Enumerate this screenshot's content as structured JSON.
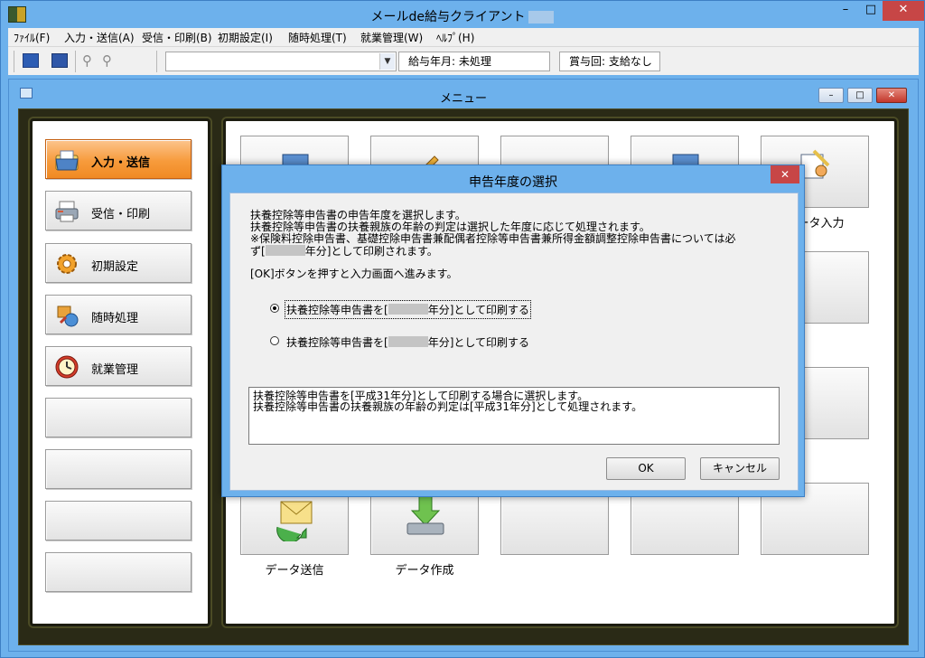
{
  "app": {
    "title": "メールde給与クライアント",
    "controls": {
      "minimize": "–",
      "maximize": "□",
      "close": "✕"
    }
  },
  "menubar": {
    "items": [
      "ﾌｧｲﾙ(F)",
      "入力・送信(A)",
      "受信・印刷(B)",
      "初期設定(I)",
      "随時処理(T)",
      "就業管理(W)",
      "ﾍﾙﾌﾟ(H)"
    ]
  },
  "toolbar": {
    "icons": [
      "monitor-icon",
      "monitor-dark-icon",
      "key-icon",
      "key-icon"
    ],
    "combo_value": "",
    "pay_label": "給与年月: 未処理",
    "bonus_label": "賞与回: 支給なし"
  },
  "mdi": {
    "title": "メニュー",
    "controls": {
      "minimize": "–",
      "maximize": "□",
      "close": "✕"
    }
  },
  "left_menu": {
    "items": [
      {
        "label": "入力・送信",
        "icon": "folder-icon",
        "active": true
      },
      {
        "label": "受信・印刷",
        "icon": "printer-icon",
        "active": false
      },
      {
        "label": "初期設定",
        "icon": "gear-icon",
        "active": false
      },
      {
        "label": "随時処理",
        "icon": "tools-icon",
        "active": false
      },
      {
        "label": "就業管理",
        "icon": "clock-icon",
        "active": false
      },
      {
        "label": "",
        "icon": "",
        "active": false
      },
      {
        "label": "",
        "icon": "",
        "active": false
      },
      {
        "label": "",
        "icon": "",
        "active": false
      },
      {
        "label": "",
        "icon": "",
        "active": false
      }
    ]
  },
  "grid": {
    "labels": {
      "data_input": "データ入力",
      "data_send": "データ送信",
      "data_create": "データ作成"
    }
  },
  "dialog": {
    "title": "申告年度の選択",
    "close": "✕",
    "lines": [
      "扶養控除等申告書の申告年度を選択します。",
      "扶養控除等申告書の扶養親族の年齢の判定は選択した年度に応じて処理されます。",
      "※保険料控除申告書、基礎控除申告書兼配偶者控除等申告書兼所得金額調整控除申告書については必",
      "年分]として印刷されます。"
    ],
    "line4_prefix": "ず[",
    "ok_instruction": "[OK]ボタンを押すと入力画面へ進みます。",
    "options": [
      {
        "prefix": "扶養控除等申告書を[",
        "suffix": "年分]として印刷する",
        "selected": true
      },
      {
        "prefix": "扶養控除等申告書を[",
        "suffix": "年分]として印刷する",
        "selected": false
      }
    ],
    "description": [
      "扶養控除等申告書を[平成31年分]として印刷する場合に選択します。",
      "扶養控除等申告書の扶養親族の年齢の判定は[平成31年分]として処理されます。"
    ],
    "ok_label": "OK",
    "cancel_label": "キャンセル"
  }
}
